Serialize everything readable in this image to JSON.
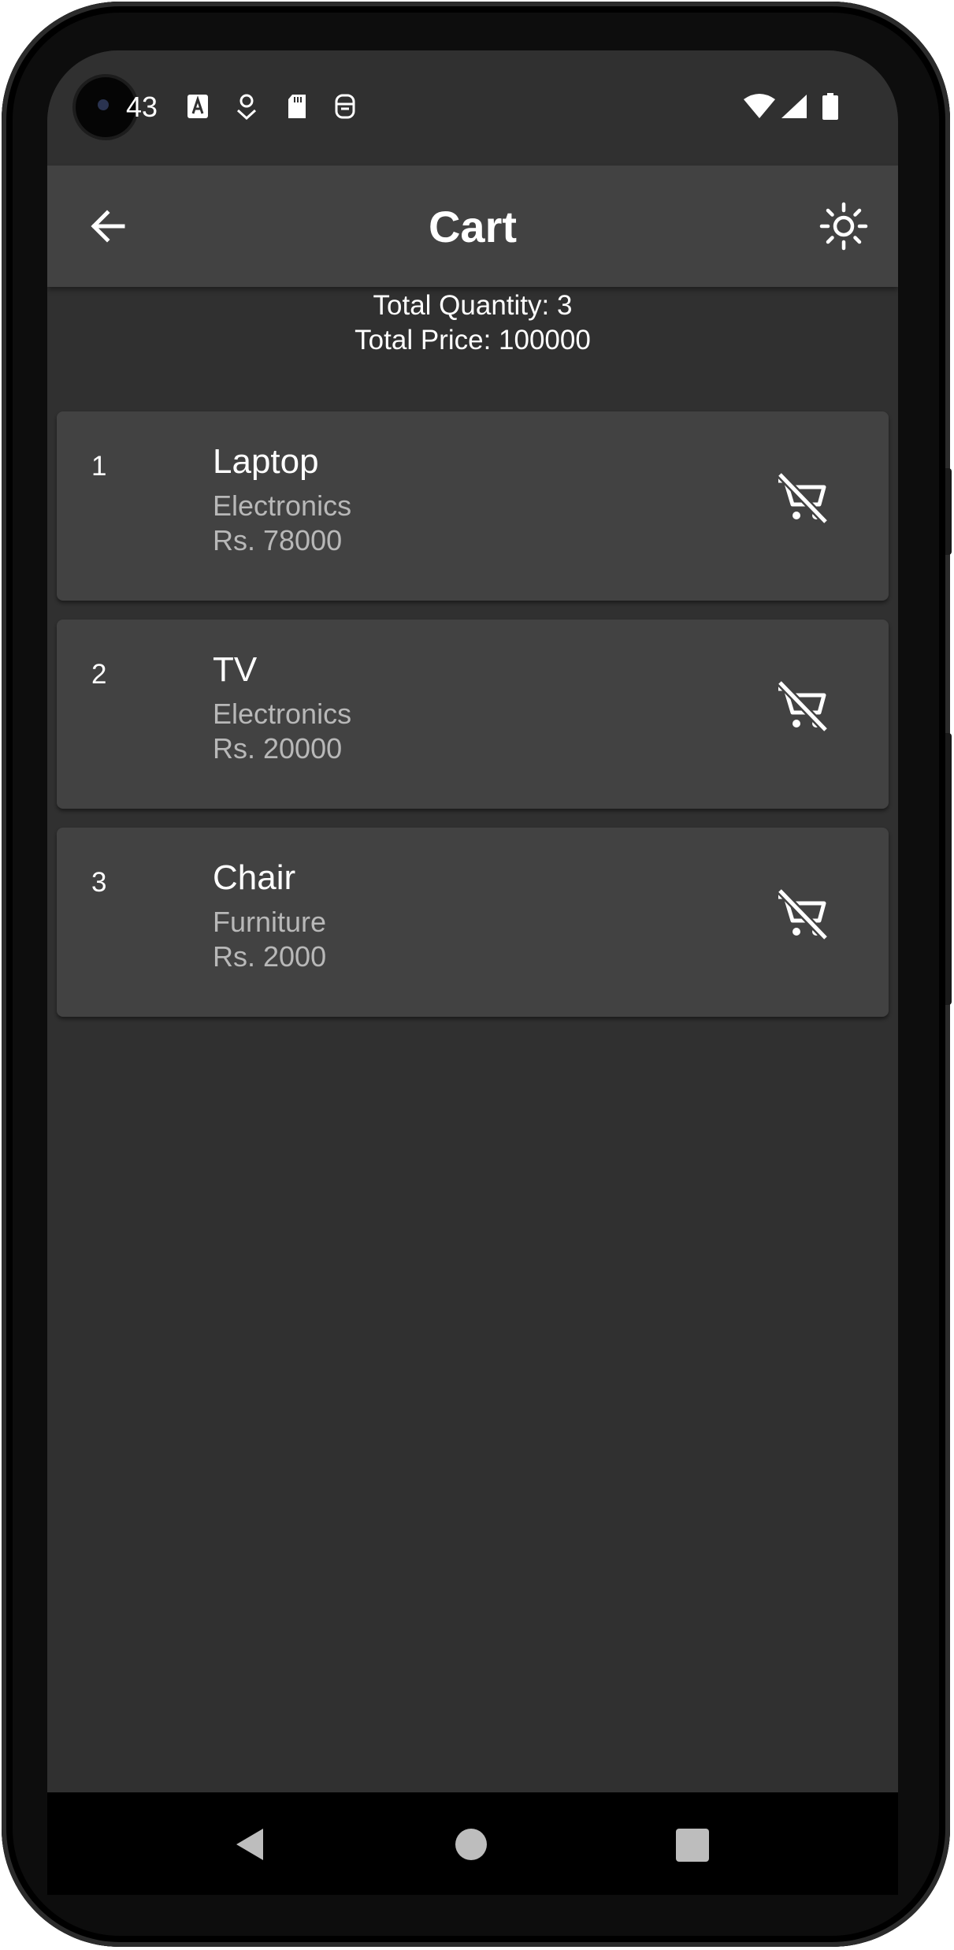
{
  "status_bar": {
    "time": "43",
    "icons": [
      "camera-cutout",
      "text-a-icon",
      "download-badge-icon",
      "sd-card-icon",
      "shield-app-icon",
      "wifi-icon",
      "cell-signal-icon",
      "battery-icon"
    ]
  },
  "app_bar": {
    "title": "Cart",
    "back_icon": "arrow-back-icon",
    "theme_icon": "sun-icon"
  },
  "summary": {
    "total_quantity": "Total Quantity: 3",
    "total_price": "Total Price: 100000"
  },
  "cart_items": [
    {
      "index": "1",
      "name": "Laptop",
      "category": "Electronics",
      "price": "Rs. 78000"
    },
    {
      "index": "2",
      "name": "TV",
      "category": "Electronics",
      "price": "Rs. 20000"
    },
    {
      "index": "3",
      "name": "Chair",
      "category": "Furniture",
      "price": "Rs. 2000"
    }
  ],
  "colors": {
    "background": "#303030",
    "app_bar": "#424242",
    "card": "#424242",
    "text_primary": "#ffffff",
    "text_secondary": "#b8b8b8"
  },
  "nav_bar": {
    "icons": [
      "nav-back-icon",
      "nav-home-icon",
      "nav-recents-icon"
    ]
  }
}
